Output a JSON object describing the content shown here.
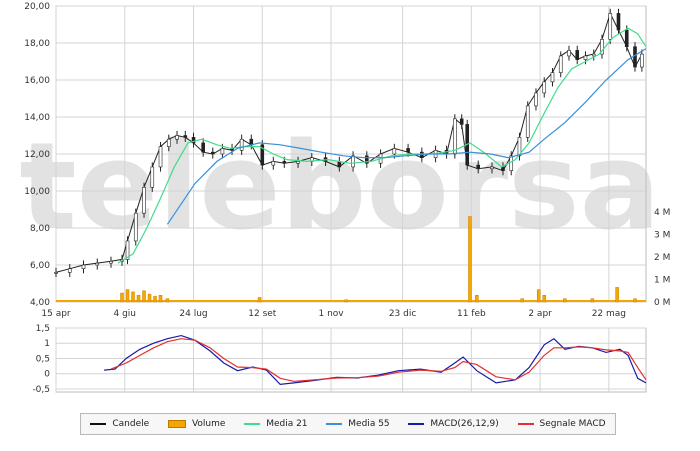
{
  "watermark": "teleborsa",
  "chart_data": {
    "type": "line",
    "x_range": [
      "2012-04-15",
      "2013-06-18"
    ],
    "x_ticks": [
      {
        "date": "2012-04-15",
        "label": "15 apr"
      },
      {
        "date": "2012-06-04",
        "label": "4 giu"
      },
      {
        "date": "2012-07-24",
        "label": "24 lug"
      },
      {
        "date": "2012-09-12",
        "label": "12 set"
      },
      {
        "date": "2012-11-01",
        "label": "1 nov"
      },
      {
        "date": "2012-12-23",
        "label": "23 dic"
      },
      {
        "date": "2013-02-11",
        "label": "11 feb"
      },
      {
        "date": "2013-04-02",
        "label": "2 apr"
      },
      {
        "date": "2013-05-22",
        "label": "22 mag"
      }
    ],
    "price_axis": {
      "ylim": [
        4,
        20
      ],
      "ticks": [
        "4,00",
        "6,00",
        "8,00",
        "10,00",
        "12,00",
        "14,00",
        "16,00",
        "18,00",
        "20,00"
      ]
    },
    "volume_axis": {
      "ylim": [
        0,
        4
      ],
      "ticks": [
        "0 M",
        "1 M",
        "2 M",
        "3 M",
        "4 M"
      ]
    },
    "macd_axis": {
      "ylim": [
        -0.6,
        1.5
      ],
      "ticks": [
        "1,5",
        "1",
        "0,5",
        "0",
        "-0,5"
      ]
    },
    "price_close": [
      [
        "2012-04-15",
        5.6
      ],
      [
        "2012-04-25",
        5.8
      ],
      [
        "2012-05-05",
        6.0
      ],
      [
        "2012-05-15",
        6.1
      ],
      [
        "2012-05-25",
        6.2
      ],
      [
        "2012-06-02",
        6.3
      ],
      [
        "2012-06-06",
        7.3
      ],
      [
        "2012-06-12",
        8.8
      ],
      [
        "2012-06-18",
        10.2
      ],
      [
        "2012-06-24",
        11.3
      ],
      [
        "2012-06-30",
        12.4
      ],
      [
        "2012-07-06",
        12.8
      ],
      [
        "2012-07-12",
        13.0
      ],
      [
        "2012-07-18",
        12.9
      ],
      [
        "2012-07-24",
        12.6
      ],
      [
        "2012-07-31",
        12.1
      ],
      [
        "2012-08-07",
        12.0
      ],
      [
        "2012-08-14",
        12.3
      ],
      [
        "2012-08-21",
        12.2
      ],
      [
        "2012-08-28",
        12.8
      ],
      [
        "2012-09-04",
        12.5
      ],
      [
        "2012-09-12",
        11.4
      ],
      [
        "2012-09-20",
        11.6
      ],
      [
        "2012-09-28",
        11.5
      ],
      [
        "2012-10-08",
        11.6
      ],
      [
        "2012-10-18",
        11.8
      ],
      [
        "2012-10-28",
        11.6
      ],
      [
        "2012-11-07",
        11.3
      ],
      [
        "2012-11-17",
        11.9
      ],
      [
        "2012-11-27",
        11.5
      ],
      [
        "2012-12-07",
        12.0
      ],
      [
        "2012-12-17",
        12.3
      ],
      [
        "2012-12-27",
        12.1
      ],
      [
        "2013-01-06",
        11.8
      ],
      [
        "2013-01-16",
        12.2
      ],
      [
        "2013-01-24",
        12.0
      ],
      [
        "2013-01-30",
        13.9
      ],
      [
        "2013-02-04",
        13.6
      ],
      [
        "2013-02-08",
        11.4
      ],
      [
        "2013-02-16",
        11.2
      ],
      [
        "2013-02-26",
        11.3
      ],
      [
        "2013-03-06",
        11.1
      ],
      [
        "2013-03-12",
        11.9
      ],
      [
        "2013-03-18",
        12.9
      ],
      [
        "2013-03-24",
        14.6
      ],
      [
        "2013-03-30",
        15.3
      ],
      [
        "2013-04-05",
        15.9
      ],
      [
        "2013-04-11",
        16.4
      ],
      [
        "2013-04-17",
        17.3
      ],
      [
        "2013-04-23",
        17.6
      ],
      [
        "2013-04-29",
        17.1
      ],
      [
        "2013-05-05",
        17.3
      ],
      [
        "2013-05-11",
        17.4
      ],
      [
        "2013-05-17",
        18.2
      ],
      [
        "2013-05-23",
        19.6
      ],
      [
        "2013-05-29",
        18.7
      ],
      [
        "2013-06-04",
        17.8
      ],
      [
        "2013-06-10",
        16.7
      ],
      [
        "2013-06-15",
        17.4
      ]
    ],
    "series": [
      {
        "name": "Media 21",
        "color": "#3fdc8a",
        "points": [
          [
            "2012-05-30",
            6.1
          ],
          [
            "2012-06-10",
            6.6
          ],
          [
            "2012-06-20",
            8.0
          ],
          [
            "2012-06-30",
            9.6
          ],
          [
            "2012-07-10",
            11.3
          ],
          [
            "2012-07-20",
            12.6
          ],
          [
            "2012-07-30",
            12.8
          ],
          [
            "2012-08-10",
            12.5
          ],
          [
            "2012-08-20",
            12.3
          ],
          [
            "2012-08-30",
            12.4
          ],
          [
            "2012-09-10",
            12.4
          ],
          [
            "2012-09-20",
            12.0
          ],
          [
            "2012-09-30",
            11.7
          ],
          [
            "2012-10-15",
            11.6
          ],
          [
            "2012-10-30",
            11.7
          ],
          [
            "2012-11-15",
            11.5
          ],
          [
            "2012-11-30",
            11.6
          ],
          [
            "2012-12-15",
            11.9
          ],
          [
            "2012-12-30",
            12.0
          ],
          [
            "2013-01-15",
            12.0
          ],
          [
            "2013-01-30",
            12.2
          ],
          [
            "2013-02-10",
            12.6
          ],
          [
            "2013-02-20",
            12.1
          ],
          [
            "2013-03-05",
            11.3
          ],
          [
            "2013-03-15",
            11.7
          ],
          [
            "2013-03-25",
            12.6
          ],
          [
            "2013-04-05",
            14.2
          ],
          [
            "2013-04-15",
            15.6
          ],
          [
            "2013-04-25",
            16.6
          ],
          [
            "2013-05-05",
            17.0
          ],
          [
            "2013-05-15",
            17.4
          ],
          [
            "2013-05-25",
            18.3
          ],
          [
            "2013-06-05",
            18.8
          ],
          [
            "2013-06-12",
            18.5
          ],
          [
            "2013-06-18",
            17.8
          ]
        ]
      },
      {
        "name": "Media 55",
        "color": "#3a8fd8",
        "points": [
          [
            "2012-07-05",
            8.2
          ],
          [
            "2012-07-15",
            9.3
          ],
          [
            "2012-07-25",
            10.4
          ],
          [
            "2012-08-10",
            11.6
          ],
          [
            "2012-08-25",
            12.3
          ],
          [
            "2012-09-10",
            12.6
          ],
          [
            "2012-09-25",
            12.5
          ],
          [
            "2012-10-10",
            12.3
          ],
          [
            "2012-10-25",
            12.1
          ],
          [
            "2012-11-10",
            11.9
          ],
          [
            "2012-11-25",
            11.8
          ],
          [
            "2012-12-10",
            11.8
          ],
          [
            "2012-12-25",
            11.9
          ],
          [
            "2013-01-10",
            12.0
          ],
          [
            "2013-01-25",
            12.0
          ],
          [
            "2013-02-10",
            12.1
          ],
          [
            "2013-02-25",
            12.0
          ],
          [
            "2013-03-10",
            11.8
          ],
          [
            "2013-03-25",
            12.1
          ],
          [
            "2013-04-05",
            12.8
          ],
          [
            "2013-04-20",
            13.7
          ],
          [
            "2013-05-05",
            14.8
          ],
          [
            "2013-05-20",
            16.0
          ],
          [
            "2013-06-05",
            17.1
          ],
          [
            "2013-06-18",
            17.7
          ]
        ]
      },
      {
        "name": "MACD(26,12,9)",
        "color": "#1a1aa8",
        "points": [
          [
            "2012-05-20",
            0.12
          ],
          [
            "2012-05-28",
            0.15
          ],
          [
            "2012-06-05",
            0.5
          ],
          [
            "2012-06-15",
            0.8
          ],
          [
            "2012-06-25",
            1.0
          ],
          [
            "2012-07-05",
            1.15
          ],
          [
            "2012-07-15",
            1.25
          ],
          [
            "2012-07-25",
            1.1
          ],
          [
            "2012-08-05",
            0.75
          ],
          [
            "2012-08-15",
            0.35
          ],
          [
            "2012-08-25",
            0.1
          ],
          [
            "2012-09-05",
            0.22
          ],
          [
            "2012-09-15",
            0.12
          ],
          [
            "2012-09-25",
            -0.35
          ],
          [
            "2012-10-05",
            -0.3
          ],
          [
            "2012-10-20",
            -0.22
          ],
          [
            "2012-11-05",
            -0.12
          ],
          [
            "2012-11-20",
            -0.14
          ],
          [
            "2012-12-05",
            -0.05
          ],
          [
            "2012-12-20",
            0.1
          ],
          [
            "2013-01-05",
            0.15
          ],
          [
            "2013-01-20",
            0.05
          ],
          [
            "2013-01-30",
            0.35
          ],
          [
            "2013-02-05",
            0.55
          ],
          [
            "2013-02-15",
            0.1
          ],
          [
            "2013-03-01",
            -0.3
          ],
          [
            "2013-03-15",
            -0.2
          ],
          [
            "2013-03-25",
            0.2
          ],
          [
            "2013-04-05",
            0.95
          ],
          [
            "2013-04-12",
            1.15
          ],
          [
            "2013-04-20",
            0.8
          ],
          [
            "2013-04-30",
            0.9
          ],
          [
            "2013-05-10",
            0.85
          ],
          [
            "2013-05-20",
            0.7
          ],
          [
            "2013-05-30",
            0.8
          ],
          [
            "2013-06-05",
            0.6
          ],
          [
            "2013-06-12",
            -0.15
          ],
          [
            "2013-06-18",
            -0.3
          ]
        ]
      },
      {
        "name": "Segnale MACD",
        "color": "#e03030",
        "points": [
          [
            "2012-05-25",
            0.15
          ],
          [
            "2012-06-05",
            0.35
          ],
          [
            "2012-06-15",
            0.6
          ],
          [
            "2012-06-25",
            0.85
          ],
          [
            "2012-07-05",
            1.05
          ],
          [
            "2012-07-15",
            1.15
          ],
          [
            "2012-07-25",
            1.1
          ],
          [
            "2012-08-05",
            0.85
          ],
          [
            "2012-08-15",
            0.5
          ],
          [
            "2012-08-25",
            0.22
          ],
          [
            "2012-09-05",
            0.2
          ],
          [
            "2012-09-15",
            0.15
          ],
          [
            "2012-09-25",
            -0.15
          ],
          [
            "2012-10-05",
            -0.25
          ],
          [
            "2012-10-20",
            -0.2
          ],
          [
            "2012-11-05",
            -0.14
          ],
          [
            "2012-11-20",
            -0.13
          ],
          [
            "2012-12-05",
            -0.08
          ],
          [
            "2012-12-20",
            0.05
          ],
          [
            "2013-01-05",
            0.12
          ],
          [
            "2013-01-20",
            0.08
          ],
          [
            "2013-01-30",
            0.2
          ],
          [
            "2013-02-05",
            0.4
          ],
          [
            "2013-02-15",
            0.3
          ],
          [
            "2013-03-01",
            -0.1
          ],
          [
            "2013-03-15",
            -0.2
          ],
          [
            "2013-03-25",
            0.05
          ],
          [
            "2013-04-05",
            0.6
          ],
          [
            "2013-04-12",
            0.85
          ],
          [
            "2013-04-20",
            0.85
          ],
          [
            "2013-04-30",
            0.88
          ],
          [
            "2013-05-10",
            0.85
          ],
          [
            "2013-05-20",
            0.78
          ],
          [
            "2013-05-30",
            0.75
          ],
          [
            "2013-06-05",
            0.7
          ],
          [
            "2013-06-12",
            0.2
          ],
          [
            "2013-06-18",
            -0.2
          ]
        ]
      }
    ],
    "volume": [
      [
        "2012-06-02",
        0.4
      ],
      [
        "2012-06-06",
        0.55
      ],
      [
        "2012-06-10",
        0.45
      ],
      [
        "2012-06-14",
        0.3
      ],
      [
        "2012-06-18",
        0.5
      ],
      [
        "2012-06-22",
        0.35
      ],
      [
        "2012-06-26",
        0.25
      ],
      [
        "2012-06-30",
        0.3
      ],
      [
        "2012-07-05",
        0.15
      ],
      [
        "2012-09-10",
        0.2
      ],
      [
        "2012-11-12",
        0.1
      ],
      [
        "2013-02-10",
        3.8
      ],
      [
        "2013-02-15",
        0.3
      ],
      [
        "2013-03-20",
        0.15
      ],
      [
        "2013-04-01",
        0.55
      ],
      [
        "2013-04-05",
        0.3
      ],
      [
        "2013-04-20",
        0.15
      ],
      [
        "2013-05-10",
        0.15
      ],
      [
        "2013-05-28",
        0.65
      ],
      [
        "2013-06-10",
        0.15
      ]
    ],
    "legend": [
      {
        "label": "Candele",
        "color": "#111111",
        "kind": "line"
      },
      {
        "label": "Volume",
        "color": "#f7a600",
        "kind": "box"
      },
      {
        "label": "Media 21",
        "color": "#3fdc8a",
        "kind": "line"
      },
      {
        "label": "Media 55",
        "color": "#3a8fd8",
        "kind": "line"
      },
      {
        "label": "MACD(26,12,9)",
        "color": "#1a1aa8",
        "kind": "line"
      },
      {
        "label": "Segnale MACD",
        "color": "#e03030",
        "kind": "line"
      }
    ],
    "grid": true,
    "legend_position": "bottom"
  }
}
